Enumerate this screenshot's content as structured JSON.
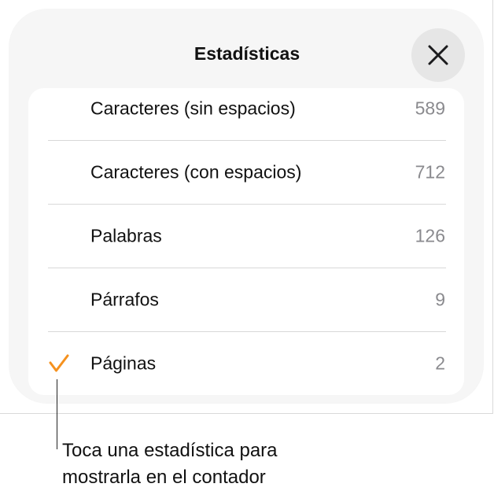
{
  "header": {
    "title": "Estadísticas",
    "close_icon": "close-icon"
  },
  "stats": [
    {
      "label": "Caracteres (sin espacios)",
      "value": "589",
      "selected": false
    },
    {
      "label": "Caracteres (con espacios)",
      "value": "712",
      "selected": false
    },
    {
      "label": "Palabras",
      "value": "126",
      "selected": false
    },
    {
      "label": "Párrafos",
      "value": "9",
      "selected": false
    },
    {
      "label": "Páginas",
      "value": "2",
      "selected": true
    }
  ],
  "callout": {
    "line1": "Toca una estadística para",
    "line2": "mostrarla en el contador"
  },
  "colors": {
    "accent": "#f5911e",
    "sheet_bg": "#f6f6f6",
    "value_text": "#8a8a8e"
  }
}
